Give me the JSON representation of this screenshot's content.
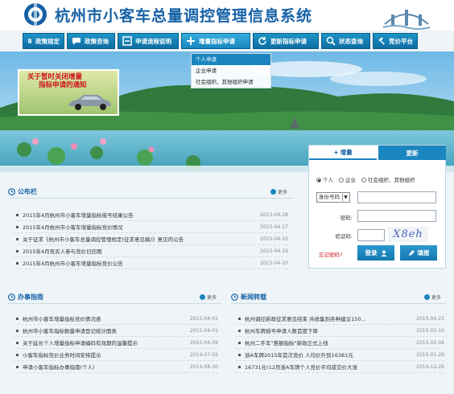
{
  "header": {
    "title": "杭州市小客车总量调控管理信息系统"
  },
  "nav": {
    "items": [
      {
        "label": "政策规定",
        "icon": "document-icon"
      },
      {
        "label": "政策咨询",
        "icon": "chat-icon"
      },
      {
        "label": "申请流程说明",
        "icon": "flow-icon"
      },
      {
        "label": "增量指标申请",
        "icon": "plus-icon"
      },
      {
        "label": "更新指标申请",
        "icon": "refresh-icon"
      },
      {
        "label": "状态查询",
        "icon": "search-icon"
      },
      {
        "label": "竞价平台",
        "icon": "gavel-icon"
      }
    ],
    "dropdown": [
      "个人申请",
      "企业申请",
      "社会组织、其他组织申请"
    ]
  },
  "notice": {
    "line1": "关于暂时关闭增量",
    "line2": "指标申请的通知"
  },
  "login": {
    "tab_add": "增量",
    "tab_update": "更新",
    "radio_personal": "个人",
    "radio_company": "企业",
    "radio_other": "社会组织、其他组织",
    "id_type": "身份号码",
    "password_label": "密码:",
    "captcha_label": "验证码:",
    "captcha_text": "X8eh",
    "forgot": "忘记密码?",
    "login_btn": "登录",
    "fill_btn": "填报"
  },
  "bulletin": {
    "title": "公布栏",
    "more": "更多",
    "items": [
      {
        "title": "2015年4月杭州市小客车增量指标摇号结果公告",
        "date": "2015-04-28"
      },
      {
        "title": "2015年4月杭州市小客车增量指标竞价情况",
        "date": "2015-04-27"
      },
      {
        "title": "关于征求《杭州市小客车总量调控管理规定(征求意见稿)》意见的公告",
        "date": "2015-04-10"
      },
      {
        "title": "2015年4月竞买人参与竞价日历图",
        "date": "2015-04-10"
      },
      {
        "title": "2015年4月杭州市小客车增量指标竞价公告",
        "date": "2015-04-10"
      }
    ]
  },
  "guide": {
    "title": "办事指南",
    "more": "更多",
    "items": [
      {
        "title": "杭州市小客车增量指标竞价情况表",
        "date": "2015-04-01"
      },
      {
        "title": "杭州市小客车指标数量申请登记统计图表",
        "date": "2015-04-01"
      },
      {
        "title": "关于延长个人增量指标申请编码有效期的温馨提示",
        "date": "2015-04-09"
      },
      {
        "title": "小客车指标竞价业务时间安排提示",
        "date": "2014-07-02"
      },
      {
        "title": "申请小客车指标办事指南(个人)",
        "date": "2014-08-30"
      }
    ]
  },
  "news": {
    "title": "新闻转载",
    "more": "更多",
    "items": [
      {
        "title": "杭州调控新政征求意见结束 共收集到各种建议150...",
        "date": "2015-04-21"
      },
      {
        "title": "杭州车牌摇号申请人数首度下降",
        "date": "2015-02-10"
      },
      {
        "title": "杭州二手车\"差额指标\"新政正式上线",
        "date": "2015-02-04"
      },
      {
        "title": "浙A车牌2015年首次竞价 人均价升到16381元",
        "date": "2015-01-29"
      },
      {
        "title": "16731元!12月浙A车牌个人竞价平均成交价大涨",
        "date": "2014-12-26"
      }
    ]
  }
}
